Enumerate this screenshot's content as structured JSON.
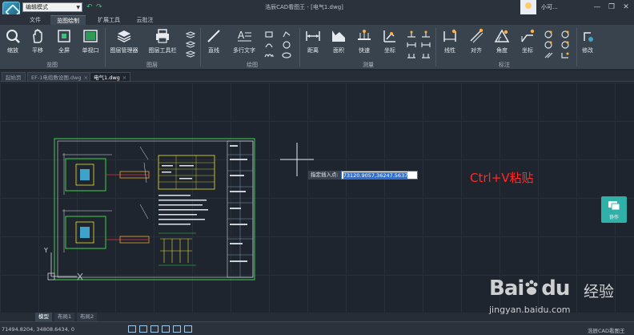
{
  "titlebar": {
    "mode_value": "编辑模式",
    "window_title": "浩辰CAD看图王 - [电气1.dwg]",
    "user_name": "小可..."
  },
  "menu": {
    "tabs": [
      "文件",
      "览图绘制",
      "扩展工具",
      "云批注"
    ],
    "active_index": 1
  },
  "ribbon": {
    "tools": {
      "zoom": "缩放",
      "pan": "平移",
      "fullscreen": "全屏",
      "single_viewport": "单视口",
      "layer_manager": "图层管理器",
      "layer_toolbar": "图层工具栏",
      "line": "直线",
      "mtext": "多行文字",
      "distance": "距离",
      "area": "面积",
      "quick": "快速",
      "coordinate": "坐标",
      "linear": "线性",
      "aligned": "对齐",
      "angle": "角度",
      "dim_coordinate": "坐标",
      "modify": "修改"
    },
    "groups": {
      "browse": "览图",
      "layer": "图层",
      "draw": "绘图",
      "measure": "测量",
      "dimension": "标注"
    }
  },
  "doctabs": [
    "起始页",
    "EF-1电缆敷设图.dwg",
    "电气1.dwg"
  ],
  "canvas": {
    "prompt_label": "指定插入点:",
    "prompt_value": "73120.9057,36247.5637",
    "annotation": "Ctrl+V粘贴",
    "collab_label": "协作",
    "axis_x": "X",
    "axis_y": "Y"
  },
  "layouttabs": [
    "模型",
    "布局1",
    "布局2"
  ],
  "status": {
    "coords": "71494.8204, 34808.6434, 0",
    "app_name": "浩辰CAD看图王"
  },
  "watermark": {
    "main": "Bai",
    "main2": "du",
    "cn": "经验",
    "url": "jingyan.baidu.com"
  },
  "colors": {
    "accent": "#3e4955",
    "annotation": "#ff2a2a",
    "collab": "#2fb0a8",
    "drawing_green": "#3bd24b",
    "drawing_yellow": "#e8e234"
  }
}
